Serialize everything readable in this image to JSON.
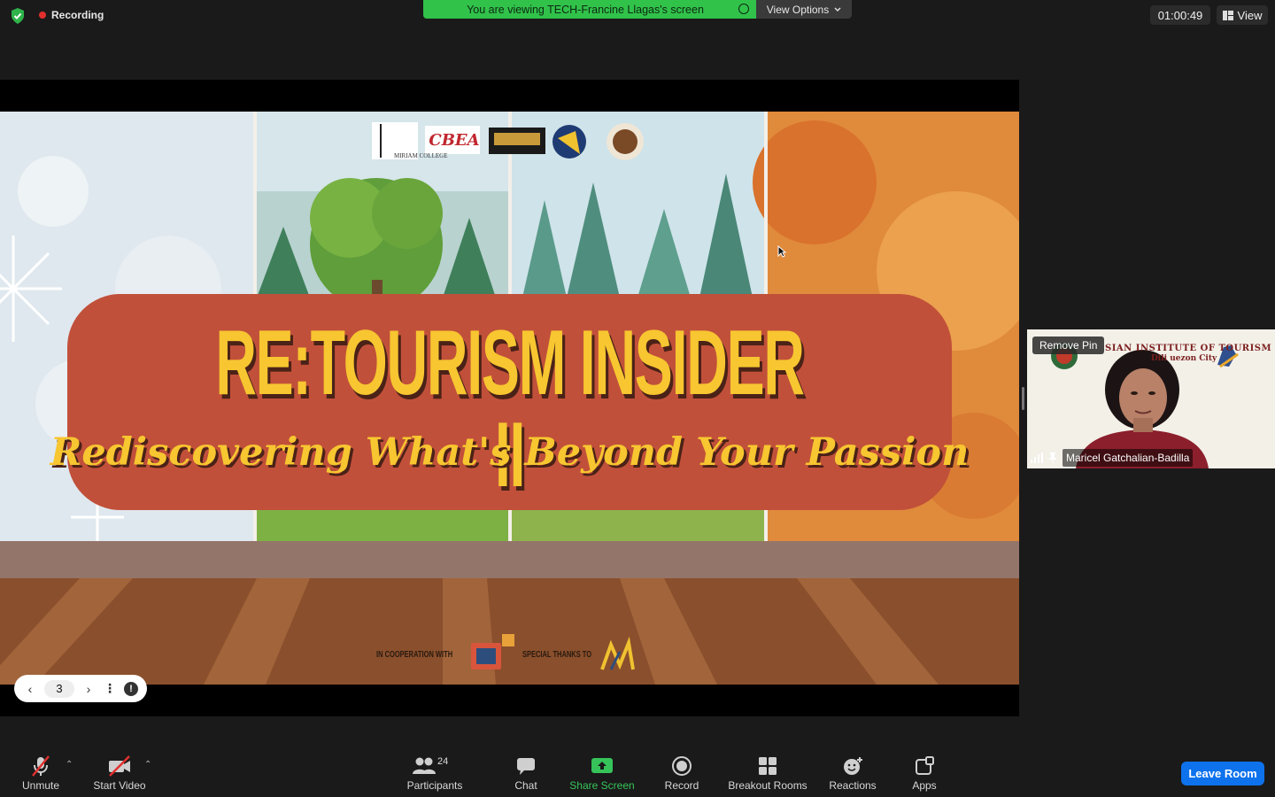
{
  "topbar": {
    "recording_label": "Recording",
    "viewing_label": "You are viewing TECH-Francine Llagas's screen",
    "view_options_label": "View Options",
    "timer": "01:00:49",
    "view_label": "View"
  },
  "slide": {
    "title": "RE:TOURISM INSIDER II",
    "subtitle": "Rediscovering What's Beyond Your Passion",
    "logo_cbea": "CBEA",
    "logo_miriam": "MIRIAM COLLEGE",
    "coop_label": "IN COOPERATION WITH",
    "thanks_label": "SPECIAL THANKS TO"
  },
  "pager": {
    "current_slide": "3"
  },
  "participant": {
    "remove_pin_label": "Remove Pin",
    "name": "Maricel Gatchalian-Badilla",
    "banner_line1": "SIAN INSTITUTE OF TOURISM",
    "banner_line2": "Dili  uezon City"
  },
  "toolbar": {
    "unmute": "Unmute",
    "start_video": "Start Video",
    "participants": "Participants",
    "participants_count": "24",
    "chat": "Chat",
    "share_screen": "Share Screen",
    "record": "Record",
    "breakout_rooms": "Breakout Rooms",
    "reactions": "Reactions",
    "apps": "Apps",
    "leave_room": "Leave Room"
  },
  "colors": {
    "share_green": "#31c24a",
    "leave_blue": "#0e72ed",
    "recording_red": "#e0302e",
    "title_yellow": "#f7c630",
    "banner_red": "#c1503a"
  }
}
